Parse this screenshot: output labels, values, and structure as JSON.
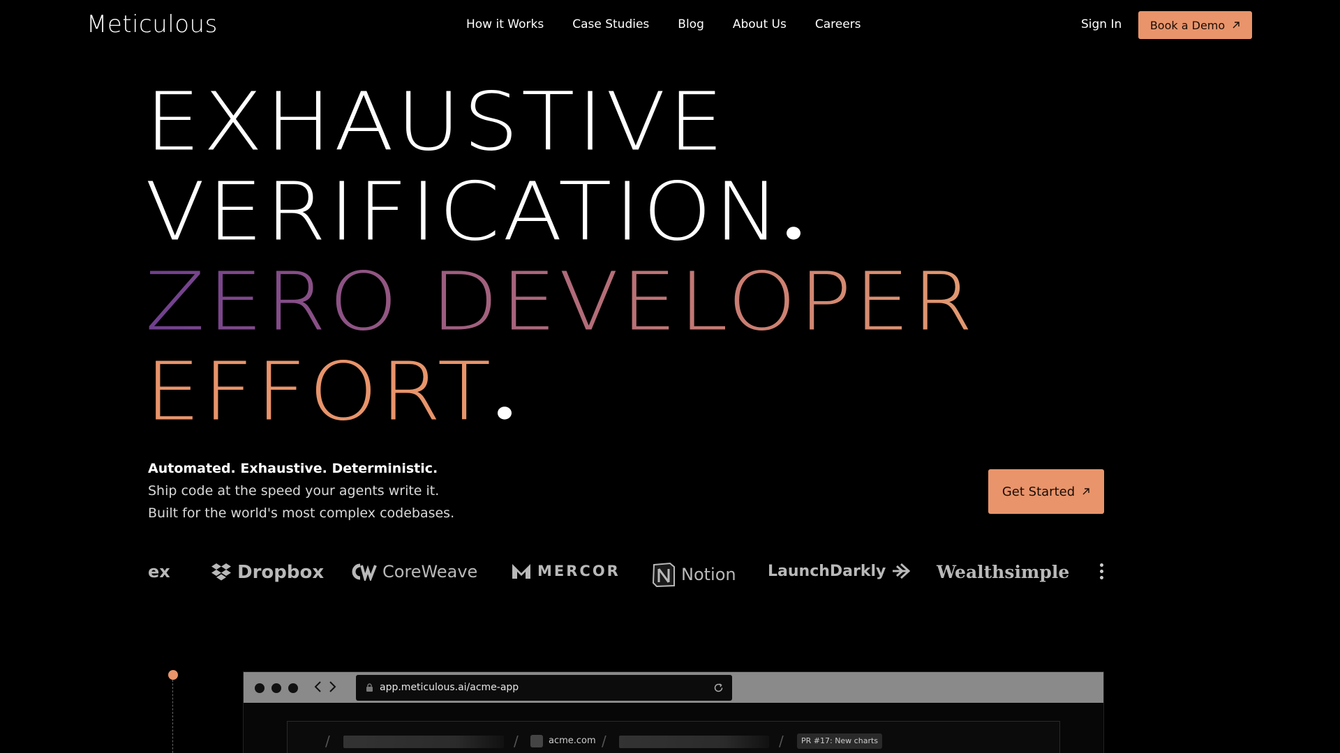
{
  "brand": {
    "name": "Meticulous"
  },
  "nav": {
    "links": [
      "How it Works",
      "Case Studies",
      "Blog",
      "About Us",
      "Careers"
    ],
    "sign_in": "Sign In",
    "cta": "Book a Demo"
  },
  "hero": {
    "line1": "EXHAUSTIVE",
    "line2": "VERIFICATION",
    "line3": "ZERO DEVELOPER",
    "line4": "EFFORT",
    "tagline_bold": "Automated. Exhaustive. Deterministic.",
    "tagline_2": "Ship code at the speed your agents write it.",
    "tagline_3": "Built for the world's most complex codebases.",
    "cta": "Get Started"
  },
  "customers": {
    "logos": [
      "ex",
      "Dropbox",
      "CoreWeave",
      "MERCOR",
      "Notion",
      "LaunchDarkly",
      "Wealthsimple"
    ]
  },
  "browser": {
    "url": "app.meticulous.ai/acme-app",
    "site": "acme.com",
    "pr_label": "PR #17: New charts"
  },
  "colors": {
    "accent": "#e9946b",
    "gradient_start": "#6f3f8f",
    "gradient_end": "#e39a70"
  }
}
